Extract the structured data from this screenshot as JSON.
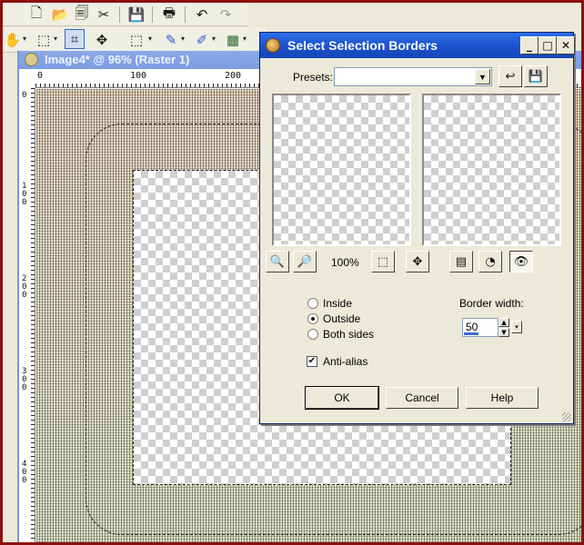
{
  "toolbar": {
    "top_icons": [
      "new-file-icon",
      "open-folder-icon",
      "browse-icon",
      "cut-icon",
      "save-icon",
      "print-icon",
      "undo-icon",
      "redo-icon"
    ],
    "tool_icons": [
      "pan-icon",
      "selection-marquee-icon",
      "crop-icon",
      "move-icon",
      "rect-selection-icon",
      "paint-brush-icon",
      "clone-brush-icon",
      "layers-icon"
    ]
  },
  "image_window": {
    "title": "Image4* @  96% (Raster 1)",
    "ruler_top": [
      "0",
      "100",
      "200"
    ],
    "ruler_left": [
      "0",
      "100",
      "200",
      "300",
      "400"
    ]
  },
  "dialog": {
    "title": "Select Selection Borders",
    "window_buttons": {
      "minimize": "_",
      "maximize": "□",
      "close": "✕"
    },
    "presets_label": "Presets:",
    "presets_value": "",
    "zoom_value": "100%",
    "options": [
      {
        "label": "Inside",
        "selected": false
      },
      {
        "label": "Outside",
        "selected": true
      },
      {
        "label": "Both sides",
        "selected": false
      }
    ],
    "anti_alias": {
      "label": "Anti-alias",
      "checked": true
    },
    "border_width": {
      "label": "Border width:",
      "value": "50"
    },
    "buttons": {
      "ok": "OK",
      "cancel": "Cancel",
      "help": "Help"
    }
  }
}
